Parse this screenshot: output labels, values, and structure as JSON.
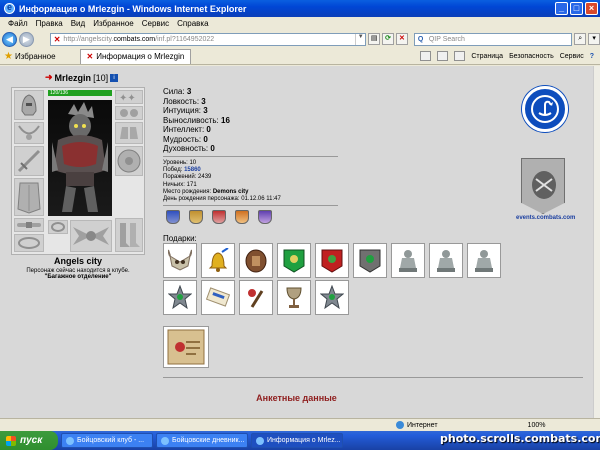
{
  "window": {
    "title": "Информация о Mrlezgin - Windows Internet Explorer"
  },
  "menu": [
    "Файл",
    "Правка",
    "Вид",
    "Избранное",
    "Сервис",
    "Справка"
  ],
  "address": {
    "prefix": "http://angelscity.",
    "host": "combats.com",
    "path": "/inf.pl?1164952022"
  },
  "search": {
    "placeholder": "QIP Search"
  },
  "favorites_label": "Избранное",
  "tab_title": "Информация о Mrlezgin",
  "commands": {
    "page": "Страница",
    "safety": "Безопасность",
    "tools": "Сервис"
  },
  "character": {
    "name": "Mrlezgin",
    "level": "[10]",
    "hp": "120/136",
    "stats": [
      {
        "label": "Сила:",
        "value": "3"
      },
      {
        "label": "Ловкость:",
        "value": "3"
      },
      {
        "label": "Интуиция:",
        "value": "3"
      },
      {
        "label": "Выносливость:",
        "value": "16"
      },
      {
        "label": "Интеллект:",
        "value": "0"
      },
      {
        "label": "Мудрость:",
        "value": "0"
      },
      {
        "label": "Духовность:",
        "value": "0"
      }
    ],
    "info": {
      "level_label": "Уровень:",
      "level_value": "10",
      "wins_label": "Побед:",
      "wins_value": "15860",
      "losses_label": "Поражений:",
      "losses_value": "2439",
      "draws_label": "Ничьих:",
      "draws_value": "171",
      "birthplace_label": "Место рождения:",
      "birthplace_value": "Demons city",
      "birthday_label": "День рождения персонажа:",
      "birthday_value": "01.12.06 11:47"
    },
    "location": {
      "city": "Angels city",
      "status": "Персонаж сейчас находится в клубе.",
      "room": "\"Багажное отделение\""
    }
  },
  "gifts_label": "Подарки:",
  "gifts_row1": [
    "skull-icon",
    "bell-icon",
    "shield-icon",
    "green-banner-icon",
    "red-banner-icon",
    "grey-banner-icon",
    "knight-statue-icon",
    "knight-statue-icon",
    "knight-statue-icon"
  ],
  "gifts_row2": [
    "star-medal-icon",
    "scroll-icon",
    "torch-icon",
    "goblet-icon",
    "star-medal-icon"
  ],
  "gifts_row3": [
    "gift-card-icon"
  ],
  "section_title": "Анкетные данные",
  "events_caption": "events.combats.com",
  "status": {
    "zone": "Интернет",
    "zoom": "100%"
  },
  "taskbar": {
    "start": "пуск",
    "tasks": [
      "Бойцовский клуб - ...",
      "Бойцовские дневник...",
      "Информация о Mrlez..."
    ]
  },
  "watermark": "photo.scrolls.combats.com",
  "colors": {
    "accent": "#1a3ea0",
    "title_red": "#902020",
    "clan_blue": "#0d4dbd"
  }
}
